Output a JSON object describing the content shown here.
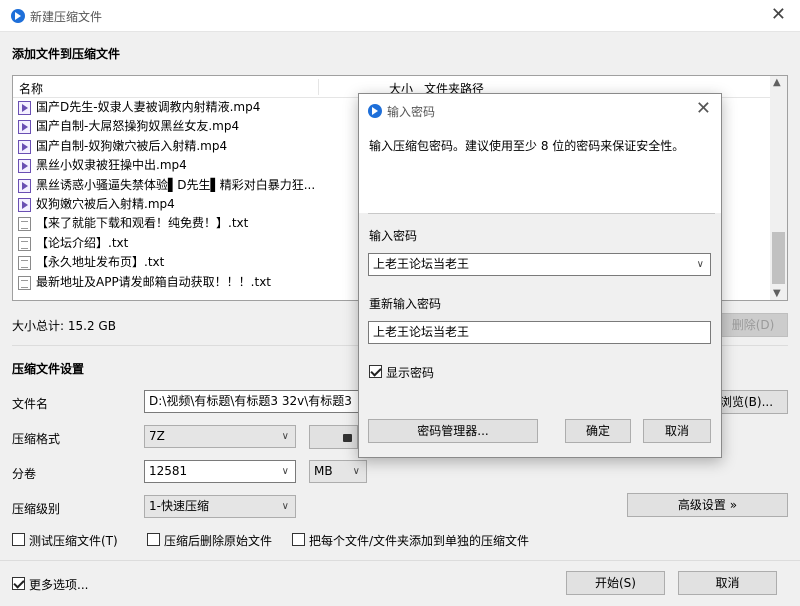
{
  "window": {
    "title": "新建压缩文件"
  },
  "section_add": "添加文件到压缩文件",
  "file_list": {
    "columns": {
      "name": "名称",
      "size": "大小",
      "path": "文件夹路径"
    },
    "items": [
      {
        "name": "国产D先生-奴隶人妻被调教内射精液.mp4",
        "type": "video"
      },
      {
        "name": "国产自制-大屌怒操狗奴黑丝女友.mp4",
        "type": "video"
      },
      {
        "name": "国产自制-奴狗嫩穴被后入射精.mp4",
        "type": "video"
      },
      {
        "name": "黑丝小奴隶被狂操中出.mp4",
        "type": "video"
      },
      {
        "name": "黑丝诱惑小骚逼失禁体验▌D先生▌精彩对白暴力狂...",
        "type": "video"
      },
      {
        "name": "奴狗嫩穴被后入射精.mp4",
        "type": "video"
      },
      {
        "name": "【来了就能下载和观看！纯免费！】.txt",
        "type": "text"
      },
      {
        "name": "【论坛介绍】.txt",
        "type": "text"
      },
      {
        "name": "【永久地址发布页】.txt",
        "type": "text"
      },
      {
        "name": "最新地址及APP请发邮箱自动获取！！！.txt",
        "type": "text"
      }
    ]
  },
  "total_size": "大小总计: 15.2 GB",
  "delete_button": "删除(D)",
  "section_settings": "压缩文件设置",
  "filename": {
    "label": "文件名",
    "value": "D:\\视频\\有标题\\有标题3 32v\\有标题3",
    "browse": "浏览(B)..."
  },
  "format": {
    "label": "压缩格式",
    "value": "7Z"
  },
  "split": {
    "label": "分卷",
    "value": "12581",
    "unit": "MB"
  },
  "level": {
    "label": "压缩级别",
    "value": "1-快速压缩"
  },
  "advanced_button": "高级设置 »",
  "options": {
    "test": "测试压缩文件(T)",
    "delete_after": "压缩后删除原始文件",
    "separate": "把每个文件/文件夹添加到单独的压缩文件"
  },
  "more_options": "更多选项...",
  "start_button": "开始(S)",
  "cancel_button": "取消",
  "password_dialog": {
    "title": "输入密码",
    "message": "输入压缩包密码。建议使用至少 8 位的密码来保证安全性。",
    "password_label": "输入密码",
    "password_value": "上老王论坛当老王",
    "confirm_label": "重新输入密码",
    "confirm_value": "上老王论坛当老王",
    "show_password": "显示密码",
    "show_password_checked": true,
    "manager_button": "密码管理器...",
    "ok_button": "确定",
    "cancel_button": "取消"
  },
  "colors": {
    "accent": "#1e6fd9",
    "video_icon": "#6a4fb3"
  }
}
